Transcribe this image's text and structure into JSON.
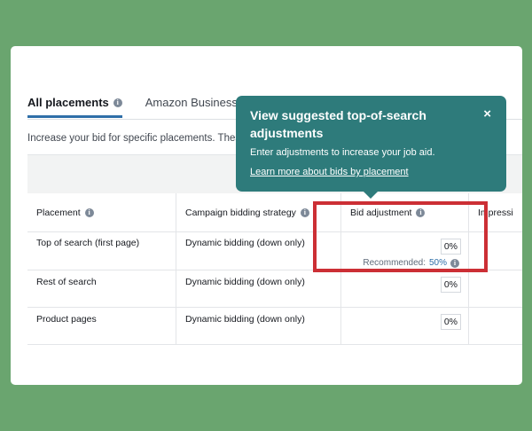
{
  "tabs": [
    {
      "label": "All placements",
      "active": true
    },
    {
      "label": "Amazon Business p",
      "active": false
    }
  ],
  "description": "Increase your bid for specific placements. These",
  "table": {
    "headers": [
      "Placement",
      "Campaign bidding strategy",
      "Bid adjustment",
      "Impressi"
    ],
    "rows": [
      {
        "placement": "Top of search (first page)",
        "strategy": "Dynamic bidding (down only)",
        "bid": "0%",
        "recommended_label": "Recommended:",
        "recommended_value": "50%"
      },
      {
        "placement": "Rest of search",
        "strategy": "Dynamic bidding (down only)",
        "bid": "0%"
      },
      {
        "placement": "Product pages",
        "strategy": "Dynamic bidding (down only)",
        "bid": "0%"
      }
    ]
  },
  "tooltip": {
    "title": "View suggested top-of-search adjustments",
    "body": "Enter adjustments to increase your job aid.",
    "link": "Learn more about bids by placement",
    "close": "×"
  },
  "colors": {
    "background": "#6aa56f",
    "tooltip": "#2e7b7b",
    "highlight": "#cc2f35",
    "tab_underline": "#2f6fa8"
  },
  "icons": {
    "info": "i"
  }
}
